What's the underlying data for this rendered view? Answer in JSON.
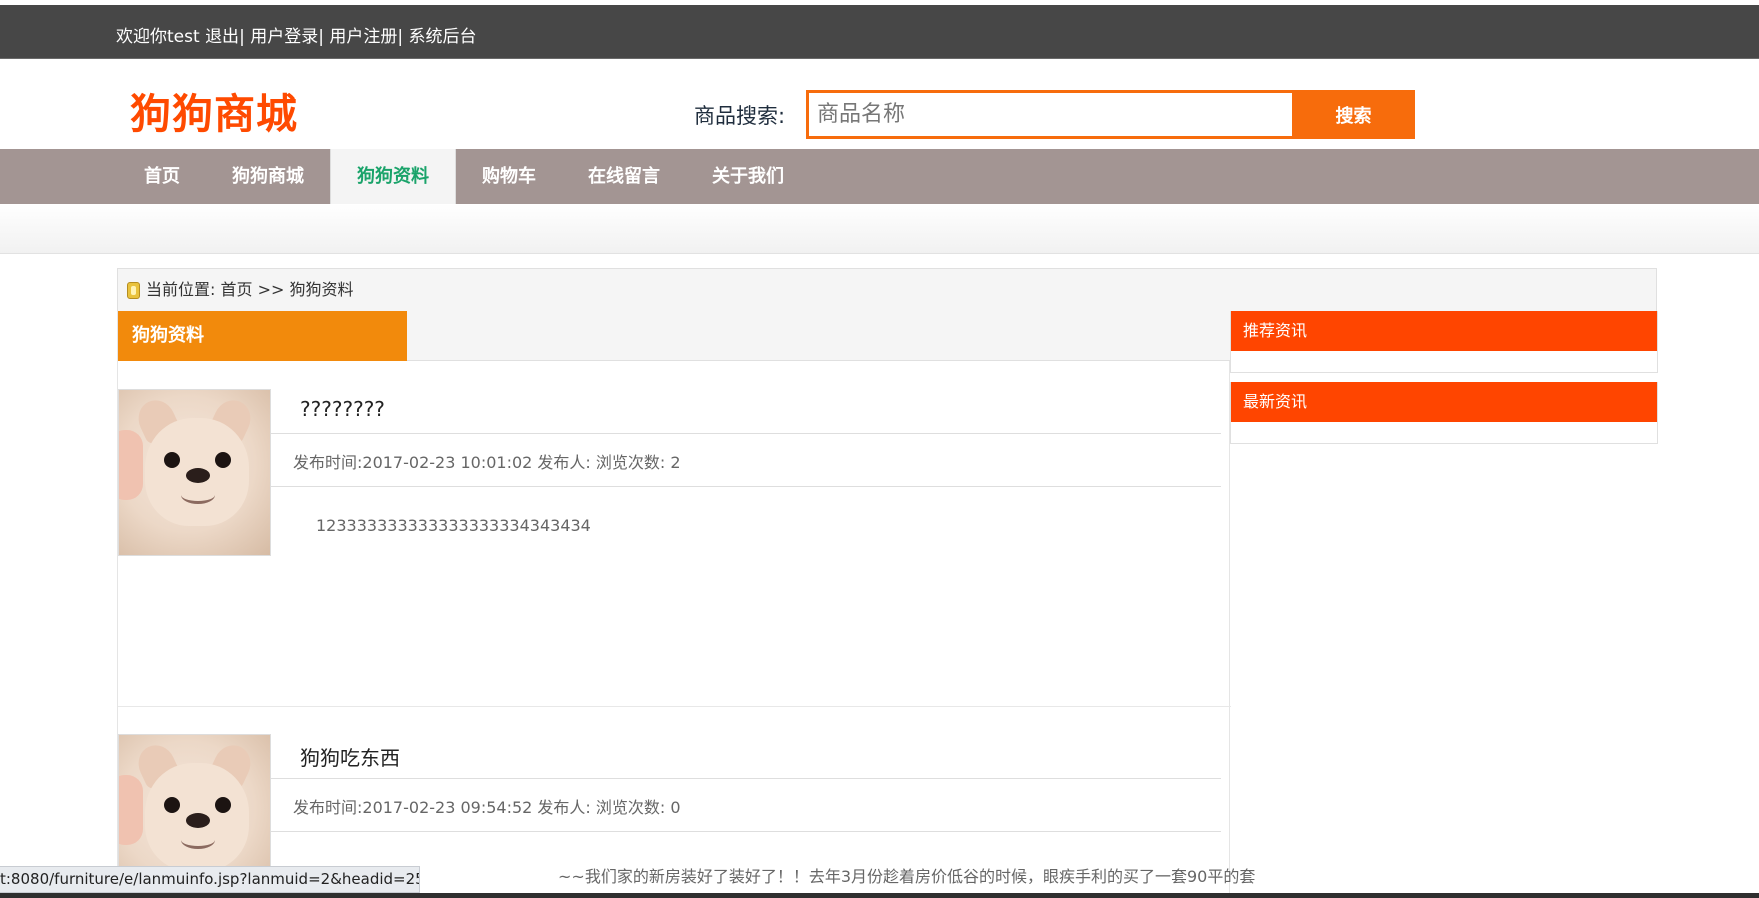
{
  "topbar": {
    "welcome": "欢迎你test ",
    "logout": "退出",
    "login": "| 用户登录",
    "register": "| 用户注册",
    "admin": "| 系统后台"
  },
  "header": {
    "logo": "狗狗商城",
    "search_label": "商品搜索:",
    "search_placeholder": "商品名称",
    "search_button": "搜索"
  },
  "nav": {
    "items": [
      {
        "label": "首页",
        "active": false
      },
      {
        "label": "狗狗商城",
        "active": false
      },
      {
        "label": "狗狗资料",
        "active": true
      },
      {
        "label": "购物车",
        "active": false
      },
      {
        "label": "在线留言",
        "active": false
      },
      {
        "label": "关于我们",
        "active": false
      }
    ]
  },
  "breadcrumb": {
    "text": "当前位置: 首页 >> 狗狗资料"
  },
  "main": {
    "section_title": "狗狗资料",
    "articles": [
      {
        "title": "????????",
        "meta": "发布时间:2017-02-23 10:01:02 发布人: 浏览次数: 2",
        "body": "123333333333333333334343434"
      },
      {
        "title": "狗狗吃东西",
        "meta": "发布时间:2017-02-23 09:54:52 发布人: 浏览次数: 0",
        "body": "~~我们家的新房装好了装好了！！去年3月份趁着房价低谷的时候，眼疾手利的买了一套90平的套"
      }
    ]
  },
  "sidebar": {
    "recommended": "推荐资讯",
    "latest": "最新资讯"
  },
  "status": {
    "url": "t:8080/furniture/e/lanmuinfo.jsp?lanmuid=2&headid=25"
  },
  "colors": {
    "topbar": "#474747",
    "logo": "#ff4a00",
    "search_accent": "#f76c0c",
    "nav": "#a39593",
    "nav_active_text": "#1aa36a",
    "section_title": "#f28a0c",
    "side_head": "#ff4500"
  },
  "icons": {
    "breadcrumb": "location-icon"
  }
}
